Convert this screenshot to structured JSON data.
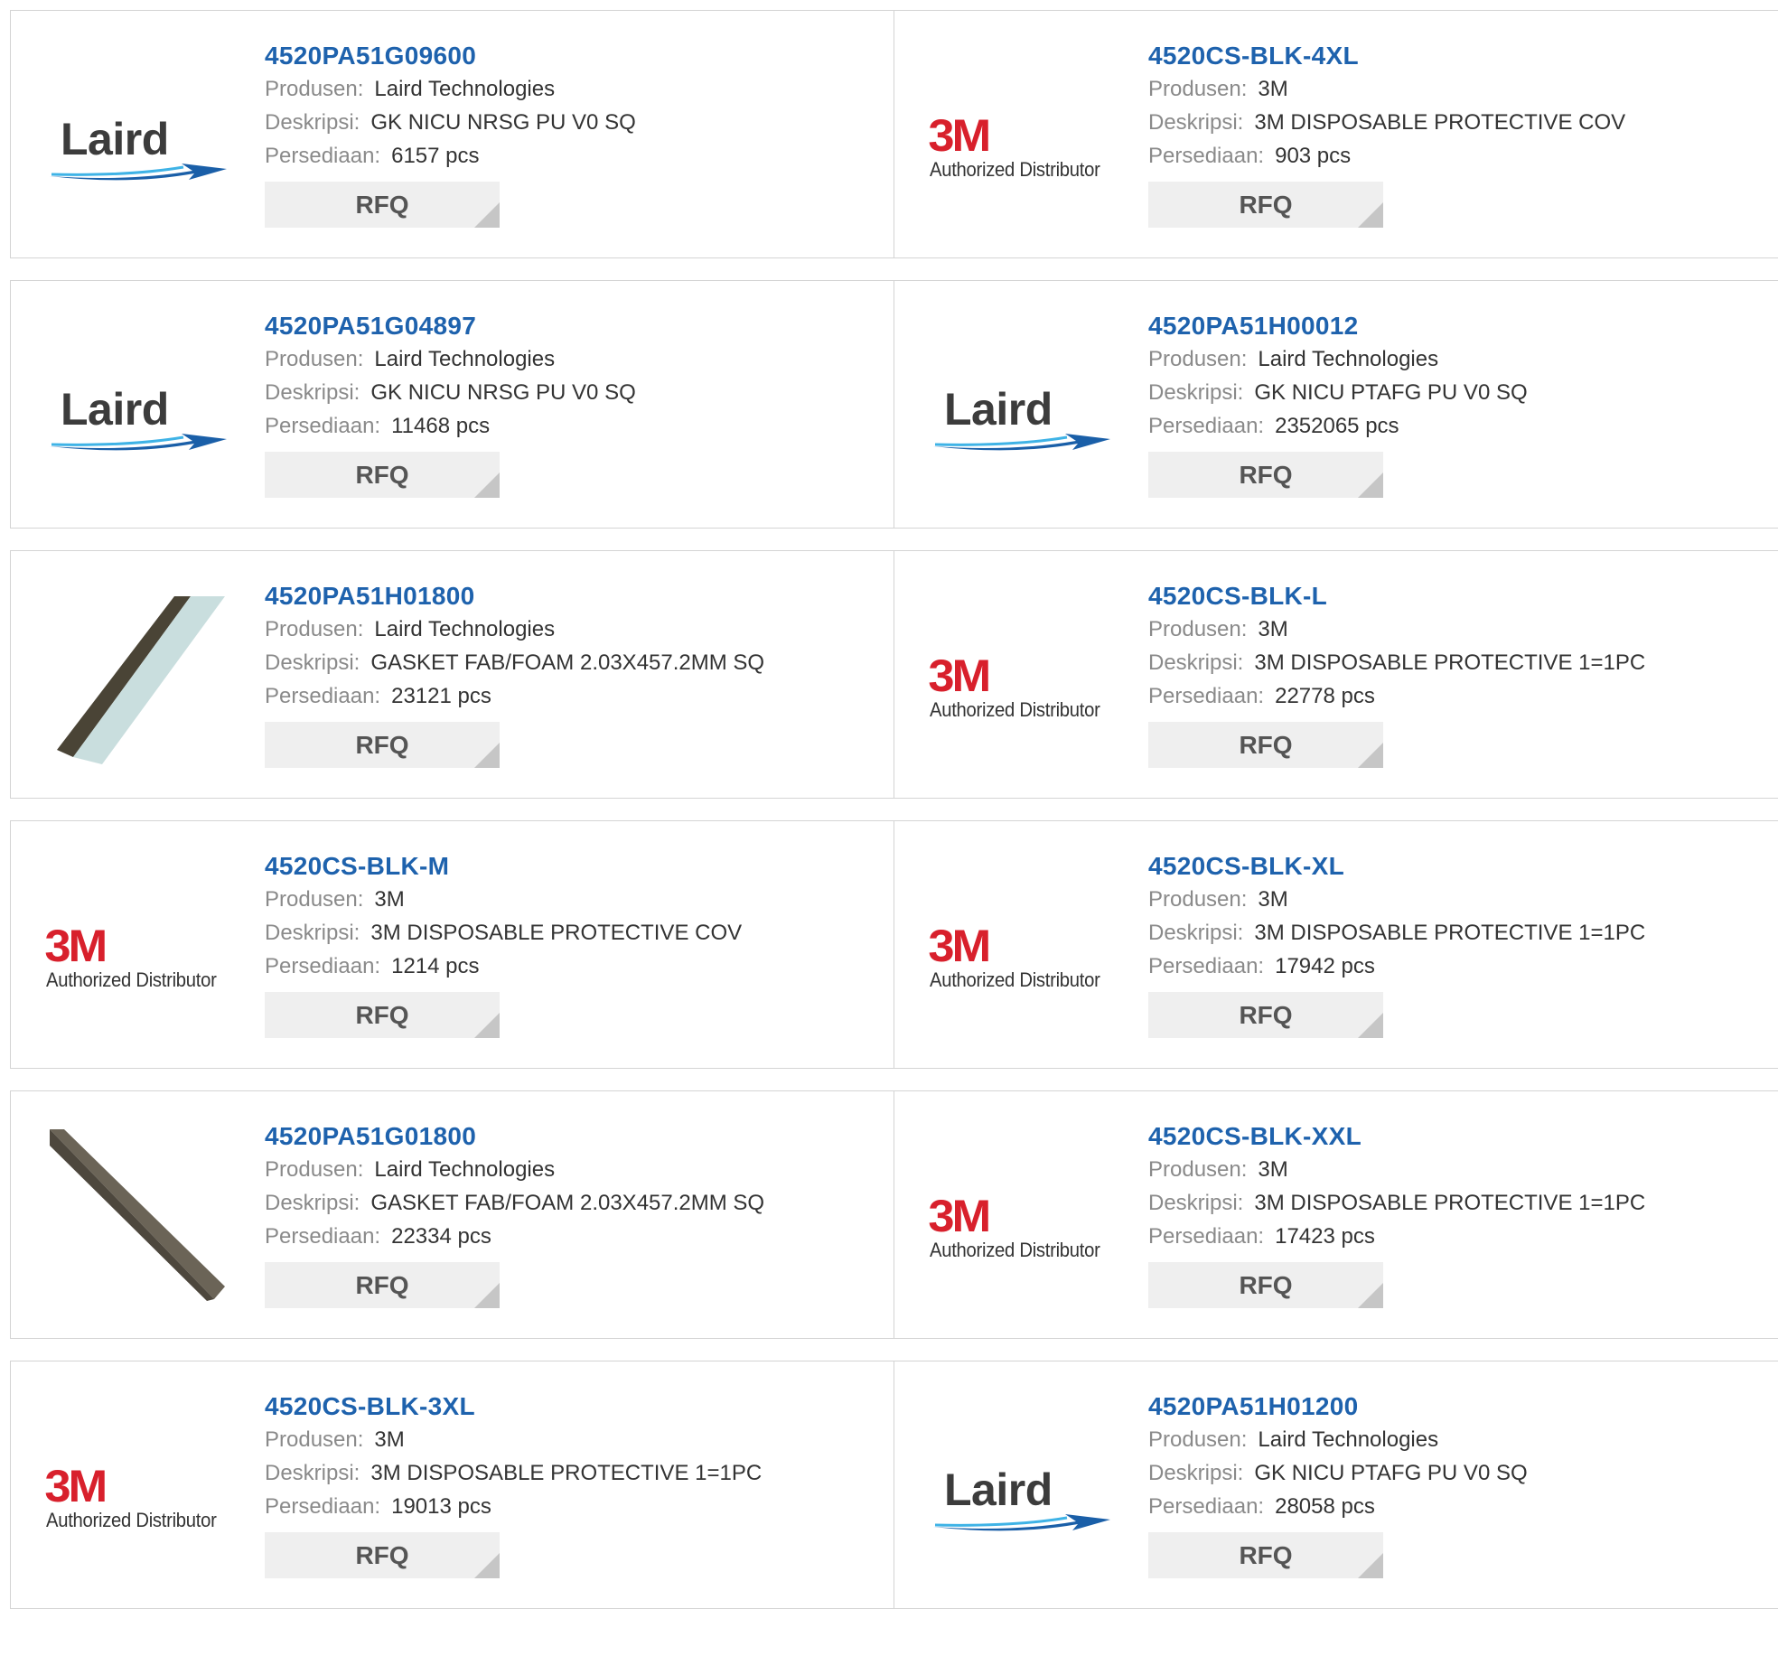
{
  "labels": {
    "manufacturer": "Produsen:",
    "description": "Deskripsi:",
    "stock": "Persediaan:",
    "rfq": "RFQ"
  },
  "logos": {
    "laird": {
      "text": "Laird",
      "colors": {
        "swoosh_dark": "#1a5fa8",
        "swoosh_light": "#3fb3e6"
      }
    },
    "3m": {
      "text": "3M",
      "distributor": "Authorized Distributor",
      "color": "#d8202c"
    }
  },
  "colors": {
    "part_number": "#1e62ad",
    "label": "#8a8a8a",
    "rfq_bg": "#efefef"
  },
  "products": [
    {
      "part": "4520PA51G09600",
      "manufacturer": "Laird Technologies",
      "description": "GK NICU NRSG PU V0 SQ",
      "stock": "6157 pcs",
      "image": "laird-logo"
    },
    {
      "part": "4520CS-BLK-4XL",
      "manufacturer": "3M",
      "description": "3M DISPOSABLE PROTECTIVE COV",
      "stock": "903 pcs",
      "image": "3m-logo"
    },
    {
      "part": "4520PA51G04897",
      "manufacturer": "Laird Technologies",
      "description": "GK NICU NRSG PU V0 SQ",
      "stock": "11468 pcs",
      "image": "laird-logo"
    },
    {
      "part": "4520PA51H00012",
      "manufacturer": "Laird Technologies",
      "description": "GK NICU PTAFG PU V0 SQ",
      "stock": "2352065 pcs",
      "image": "laird-logo"
    },
    {
      "part": "4520PA51H01800",
      "manufacturer": "Laird Technologies",
      "description": "GASKET FAB/FOAM 2.03X457.2MM SQ",
      "stock": "23121 pcs",
      "image": "gasket-photo-1"
    },
    {
      "part": "4520CS-BLK-L",
      "manufacturer": "3M",
      "description": "3M DISPOSABLE PROTECTIVE 1=1PC",
      "stock": "22778 pcs",
      "image": "3m-logo"
    },
    {
      "part": "4520CS-BLK-M",
      "manufacturer": "3M",
      "description": "3M DISPOSABLE PROTECTIVE COV",
      "stock": "1214 pcs",
      "image": "3m-logo"
    },
    {
      "part": "4520CS-BLK-XL",
      "manufacturer": "3M",
      "description": "3M DISPOSABLE PROTECTIVE 1=1PC",
      "stock": "17942 pcs",
      "image": "3m-logo"
    },
    {
      "part": "4520PA51G01800",
      "manufacturer": "Laird Technologies",
      "description": "GASKET FAB/FOAM 2.03X457.2MM SQ",
      "stock": "22334 pcs",
      "image": "gasket-photo-2"
    },
    {
      "part": "4520CS-BLK-XXL",
      "manufacturer": "3M",
      "description": "3M DISPOSABLE PROTECTIVE 1=1PC",
      "stock": "17423 pcs",
      "image": "3m-logo"
    },
    {
      "part": "4520CS-BLK-3XL",
      "manufacturer": "3M",
      "description": "3M DISPOSABLE PROTECTIVE 1=1PC",
      "stock": "19013 pcs",
      "image": "3m-logo"
    },
    {
      "part": "4520PA51H01200",
      "manufacturer": "Laird Technologies",
      "description": "GK NICU PTAFG PU V0 SQ",
      "stock": "28058 pcs",
      "image": "laird-logo"
    }
  ]
}
